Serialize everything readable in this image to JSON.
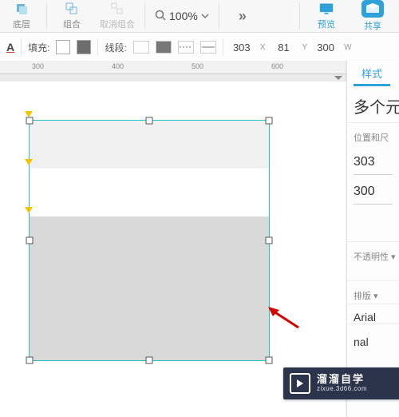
{
  "toolbar": {
    "back_label": "底层",
    "group_label": "组合",
    "ungroup_label": "取消组合",
    "zoom_value": "100%",
    "more_label": "更多",
    "preview_label": "预览",
    "share_label": "共享"
  },
  "properties": {
    "fill_label": "填充:",
    "line_label": "线段:",
    "x_value": "303",
    "x_label": "X",
    "y_value": "81",
    "y_label": "Y",
    "w_value": "300",
    "w_label": "W"
  },
  "ruler": {
    "ticks": [
      "300",
      "400",
      "500",
      "600"
    ]
  },
  "side_panel": {
    "tab_style": "样式",
    "selection_title": "多个元",
    "section_position": "位置和尺",
    "pos_x": "303",
    "size_w": "300",
    "section_opacity": "不透明性 ▾",
    "section_typography": "排版 ▾",
    "font_family": "Arial",
    "font_weight": "nal"
  },
  "watermark": {
    "title": "溜溜自学",
    "subtitle": "zixue.3d66.com"
  }
}
